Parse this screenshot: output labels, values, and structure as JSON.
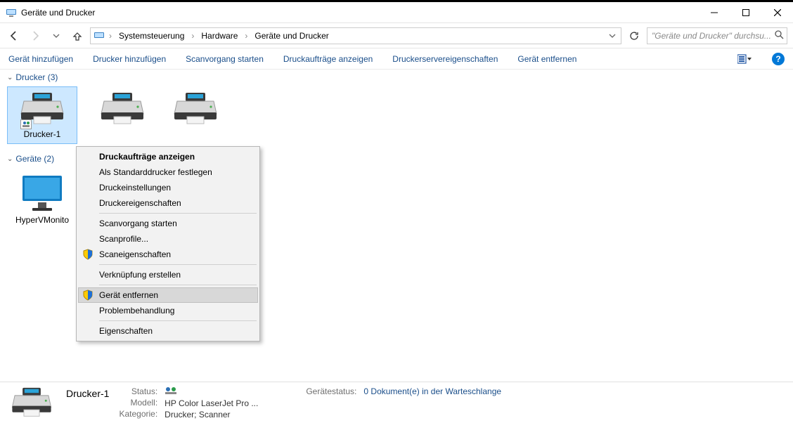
{
  "titlebar": {
    "title": "Geräte und Drucker"
  },
  "breadcrumb": {
    "root_icon": "control-panel",
    "segments": [
      "Systemsteuerung",
      "Hardware",
      "Geräte und Drucker"
    ]
  },
  "search": {
    "placeholder": "\"Geräte und Drucker\" durchsu..."
  },
  "toolbar": {
    "add_device": "Gerät hinzufügen",
    "add_printer": "Drucker hinzufügen",
    "start_scan": "Scanvorgang starten",
    "show_jobs": "Druckaufträge anzeigen",
    "server_props": "Druckerservereigenschaften",
    "remove_device": "Gerät entfernen"
  },
  "groups": {
    "printers": {
      "header": "Drucker (3)",
      "items": [
        {
          "label": "Drucker-1",
          "shared": true,
          "selected": true
        },
        {
          "label": "",
          "shared": false,
          "selected": false
        },
        {
          "label": "",
          "shared": false,
          "selected": false
        }
      ]
    },
    "devices": {
      "header": "Geräte (2)",
      "items": [
        {
          "label": "HyperVMonito"
        }
      ]
    }
  },
  "context_menu": {
    "items": [
      {
        "label": "Druckaufträge anzeigen",
        "bold": true
      },
      {
        "label": "Als Standarddrucker festlegen"
      },
      {
        "label": "Druckeinstellungen"
      },
      {
        "label": "Druckereigenschaften"
      },
      {
        "sep": true
      },
      {
        "label": "Scanvorgang starten"
      },
      {
        "label": "Scanprofile..."
      },
      {
        "label": "Scaneigenschaften",
        "shield": true
      },
      {
        "sep": true
      },
      {
        "label": "Verknüpfung erstellen"
      },
      {
        "sep": true
      },
      {
        "label": "Gerät entfernen",
        "shield": true,
        "hover": true
      },
      {
        "label": "Problembehandlung"
      },
      {
        "sep": true
      },
      {
        "label": "Eigenschaften"
      }
    ]
  },
  "details": {
    "name": "Drucker-1",
    "labels": {
      "status": "Status:",
      "model": "Modell:",
      "category": "Kategorie:"
    },
    "values": {
      "status_icon": "shared",
      "model": "HP Color LaserJet Pro ...",
      "category": "Drucker; Scanner"
    },
    "device_status_label": "Gerätestatus:",
    "device_status_value": "0 Dokument(e) in der Warteschlange"
  }
}
